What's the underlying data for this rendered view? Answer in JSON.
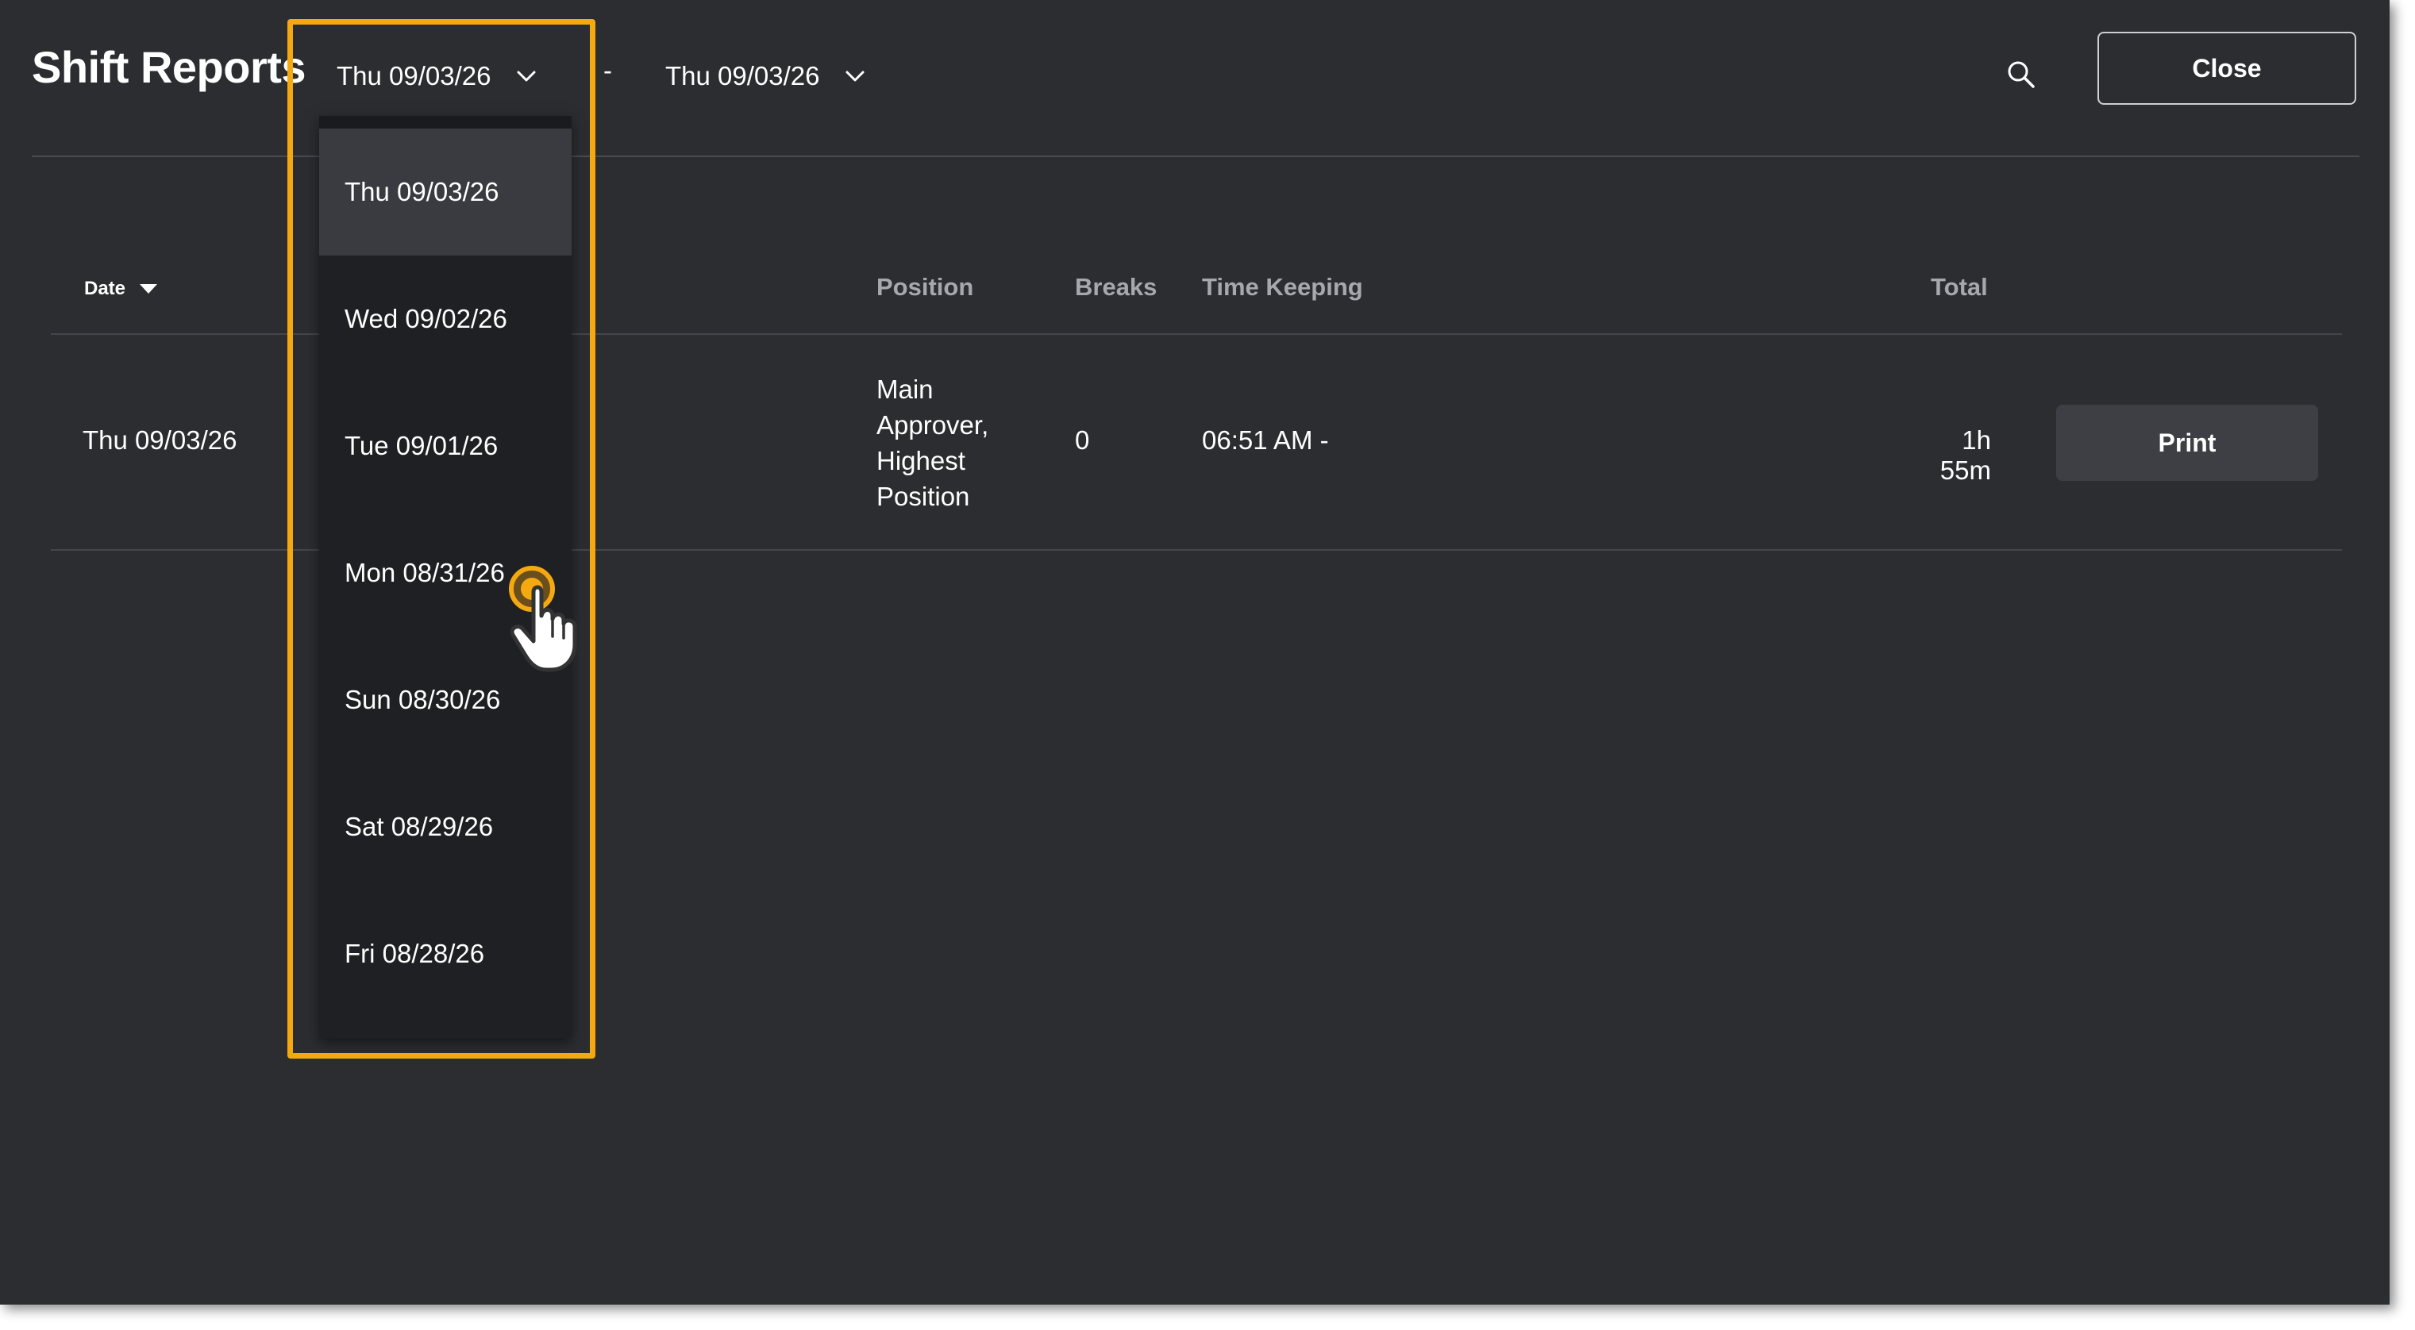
{
  "header": {
    "title": "Shift Reports",
    "start_date": "Thu 09/03/26",
    "range_separator": "-",
    "end_date": "Thu 09/03/26",
    "search_icon": "search-icon",
    "close_label": "Close"
  },
  "table": {
    "columns": {
      "date": "Date",
      "position": "Position",
      "breaks": "Breaks",
      "time_keeping": "Time Keeping",
      "total": "Total"
    },
    "rows": [
      {
        "date": "Thu 09/03/26",
        "position": "Main Approver, Highest Position",
        "breaks": "0",
        "time_keeping": "06:51 AM -",
        "total": "1h 55m",
        "print_label": "Print"
      }
    ]
  },
  "dropdown": {
    "selected_index": 0,
    "options": [
      "Thu 09/03/26",
      "Wed 09/02/26",
      "Tue 09/01/26",
      "Mon 08/31/26",
      "Sun 08/30/26",
      "Sat 08/29/26",
      "Fri 08/28/26"
    ]
  },
  "colors": {
    "background": "#2c2d31",
    "dropdown_bg": "#1f2024",
    "selected_option_bg": "#3a3b40",
    "highlight": "#f5a910",
    "muted_text": "#a7a8ad",
    "print_button_bg": "#3e3f44"
  }
}
